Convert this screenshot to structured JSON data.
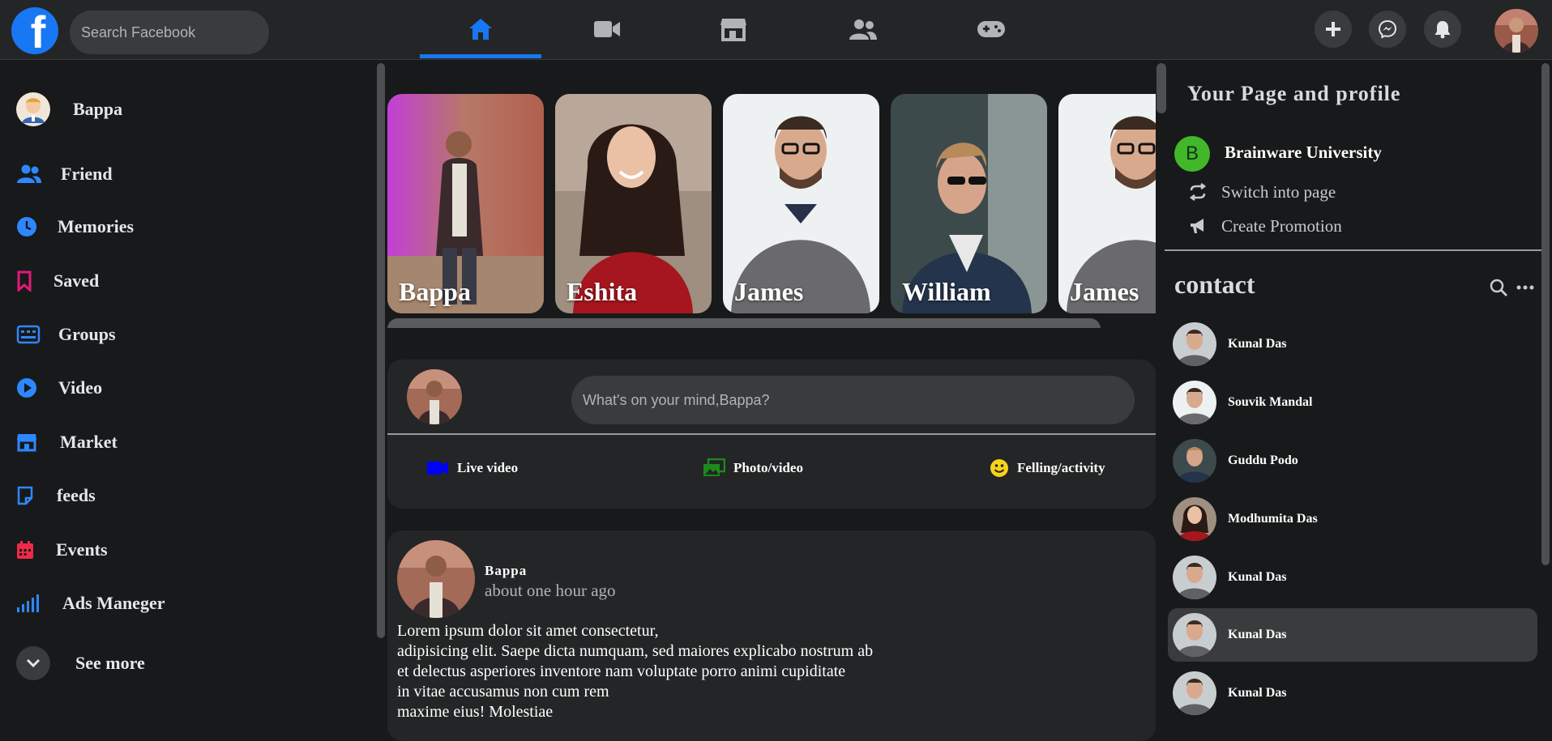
{
  "header": {
    "logo_letter": "f",
    "search_placeholder": "Search Facebook",
    "nav_tabs": [
      "home",
      "video",
      "marketplace",
      "groups",
      "gaming"
    ],
    "active_tab": "home",
    "accent": "#1877f2"
  },
  "sidebar": {
    "profile_name": "Bappa",
    "items": [
      {
        "label": "Friend",
        "icon": "friends-icon",
        "color": "#2d88ff"
      },
      {
        "label": "Memories",
        "icon": "clock-icon",
        "color": "#2d88ff"
      },
      {
        "label": "Saved",
        "icon": "bookmark-icon",
        "color": "#e4197a"
      },
      {
        "label": "Groups",
        "icon": "groups-icon",
        "color": "#2d88ff"
      },
      {
        "label": "Video",
        "icon": "play-icon",
        "color": "#2d88ff"
      },
      {
        "label": "Market",
        "icon": "store-icon",
        "color": "#2d88ff"
      },
      {
        "label": "feeds",
        "icon": "feeds-icon",
        "color": "#2d88ff"
      },
      {
        "label": "Events",
        "icon": "calendar-icon",
        "color": "#f02849"
      },
      {
        "label": "Ads Maneger",
        "icon": "signal-bars-icon",
        "color": "#2d88ff"
      }
    ],
    "see_more": "See more"
  },
  "stories": [
    {
      "name": "Bappa"
    },
    {
      "name": "Eshita"
    },
    {
      "name": "James"
    },
    {
      "name": "William"
    },
    {
      "name": "James"
    }
  ],
  "composer": {
    "placeholder": "What's on your mind,Bappa?",
    "actions": [
      {
        "label": "Live video",
        "icon": "video-camera-icon",
        "color": "#0000ff"
      },
      {
        "label": "Photo/video",
        "icon": "photos-icon",
        "color": "#1b8a1b"
      },
      {
        "label": "Felling/activity",
        "icon": "smiley-icon",
        "color": "#f7d417"
      }
    ]
  },
  "post": {
    "author": "Bappa",
    "time": "about one hour ago",
    "body": "Lorem ipsum dolor sit amet consectetur,\nadipisicing elit. Saepe dicta numquam, sed maiores explicabo nostrum ab\net delectus asperiores inventore nam voluptate porro animi cupiditate\nin vitae accusamus non cum rem\nmaxime eius! Molestiae"
  },
  "right": {
    "title": "Your Page and profile",
    "page_badge": "B",
    "page_name": "Brainware University",
    "switch_label": "Switch into page",
    "promo_label": "Create Promotion",
    "contact_title": "contact",
    "contacts": [
      {
        "name": "Kunal Das",
        "highlighted": false
      },
      {
        "name": "Souvik Mandal",
        "highlighted": false
      },
      {
        "name": "Guddu Podo",
        "highlighted": false
      },
      {
        "name": "Modhumita Das",
        "highlighted": false
      },
      {
        "name": "Kunal Das",
        "highlighted": false
      },
      {
        "name": "Kunal Das",
        "highlighted": true
      },
      {
        "name": "Kunal Das",
        "highlighted": false
      }
    ]
  }
}
